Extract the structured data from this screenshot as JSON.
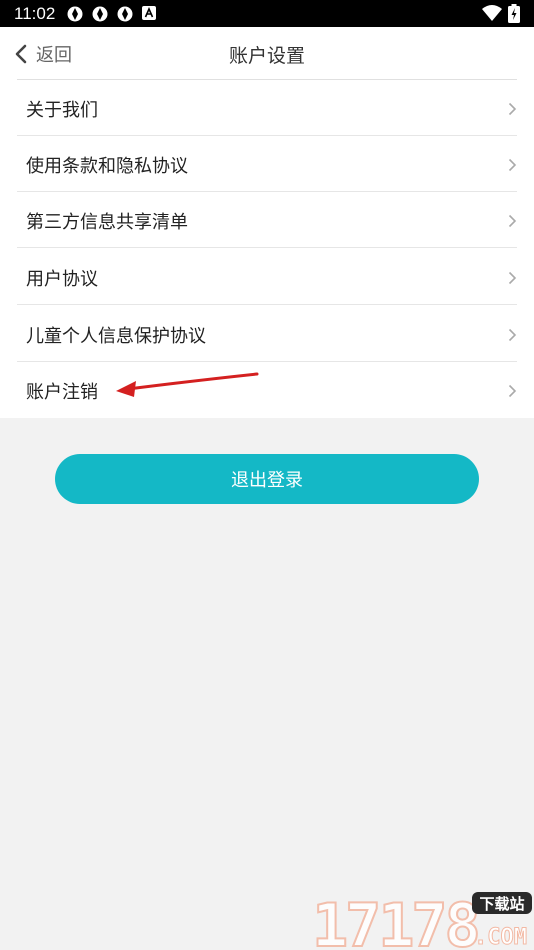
{
  "status_bar": {
    "time": "11:02"
  },
  "nav": {
    "back_label": "返回",
    "title": "账户设置"
  },
  "menu": {
    "items": [
      {
        "label": "关于我们"
      },
      {
        "label": "使用条款和隐私协议"
      },
      {
        "label": "第三方信息共享清单"
      },
      {
        "label": "用户协议"
      },
      {
        "label": "儿童个人信息保护协议"
      },
      {
        "label": "账户注销"
      }
    ]
  },
  "logout_button": {
    "label": "退出登录"
  },
  "watermark": {
    "text": "17178",
    "badge": "下载站",
    "domain": ".COM"
  },
  "colors": {
    "accent": "#14b8c6",
    "annotation": "#d42020"
  }
}
